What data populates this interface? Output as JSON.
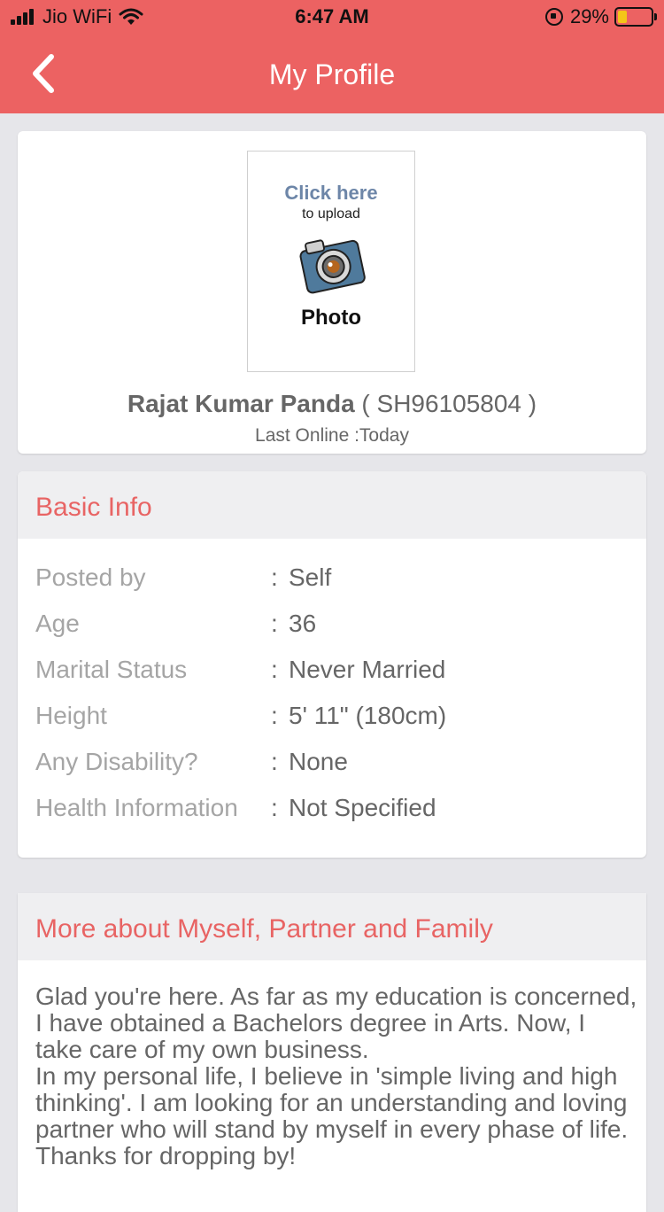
{
  "status_bar": {
    "carrier": "Jio WiFi",
    "time": "6:47 AM",
    "battery_percent": "29%",
    "battery_level": 0.29
  },
  "nav": {
    "title": "My Profile",
    "back_icon": "chevron-left-icon"
  },
  "profile": {
    "upload_click": "Click here",
    "upload_sub": "to upload",
    "upload_photo": "Photo",
    "name": "Rajat Kumar Panda",
    "profile_id": "( SH96105804 )",
    "last_online": "Last Online :Today"
  },
  "basic_info": {
    "title": "Basic Info",
    "rows": [
      {
        "label": "Posted by",
        "value": "Self"
      },
      {
        "label": "Age",
        "value": "36"
      },
      {
        "label": "Marital Status",
        "value": "Never Married"
      },
      {
        "label": "Height",
        "value": "5' 11\" (180cm)"
      },
      {
        "label": "Any Disability?",
        "value": "None"
      },
      {
        "label": "Health Information",
        "value": "Not Specified"
      }
    ]
  },
  "about": {
    "title": "More about Myself, Partner and Family",
    "text": "Glad you're here. As far as my education is concerned, I have obtained a Bachelors degree in Arts. Now, I take care of my own business.\nIn my personal life, I believe in 'simple living and high thinking'. I am looking for an understanding and loving partner who will stand by myself in every phase of life. Thanks for dropping by!"
  },
  "colors": {
    "header": "#ec6262",
    "accent_text": "#e86464",
    "background": "#e6e6ea"
  }
}
